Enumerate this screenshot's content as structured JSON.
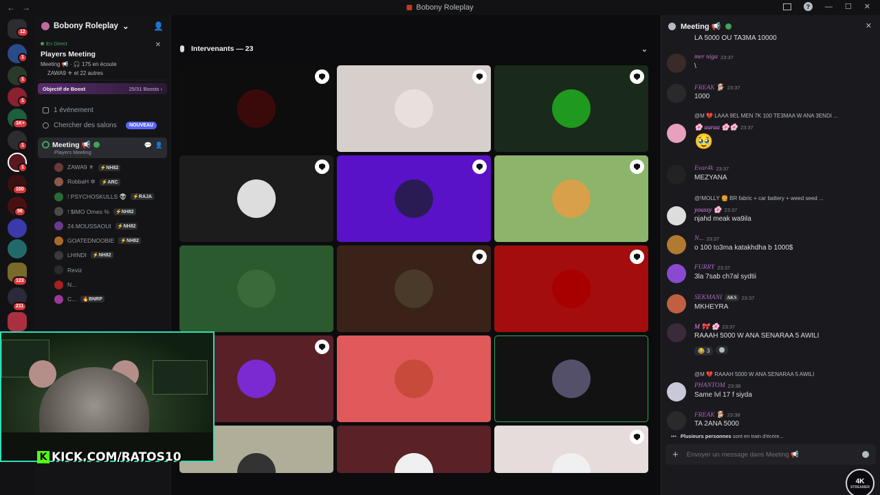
{
  "window": {
    "title": "Bobony Roleplay",
    "back": "←",
    "forward": "→",
    "help": "?"
  },
  "rail": {
    "badges": [
      "12",
      "1",
      "1",
      "1",
      "1K+",
      "1",
      "1",
      "100",
      "56",
      "123",
      "211"
    ]
  },
  "guild": {
    "name": "Bobony Roleplay"
  },
  "live": {
    "status": "En Direct",
    "title": "Players Meeting",
    "stats": "Meeting 📢 · 🎧 175 en écoute",
    "speakers": "ZAWA9 ⚜ et 22 autres"
  },
  "boost": {
    "label": "Objectif de Boost",
    "progress": "25/31 Boosts ›",
    "progress_ratio": 0.806
  },
  "nav": {
    "events": "1 événement",
    "browse": "Chercher des salons",
    "new_badge": "NOUVEAU"
  },
  "voice_channel": {
    "name": "Meeting 📢",
    "subtitle": "Players Meeting"
  },
  "members": [
    {
      "name": "ZAWA9 ⚜",
      "tag": "⚡NH82"
    },
    {
      "name": "RobbaH ✲",
      "tag": "⚡ARC"
    },
    {
      "name": "! PSYCHOSKULLS 👽",
      "tag": "⚡RAJA"
    },
    {
      "name": "! $IMO Ornes %",
      "tag": "⚡NH82"
    },
    {
      "name": "24.MOUSSAOUI",
      "tag": "⚡NH82"
    },
    {
      "name": "GOATEDNOOBIE",
      "tag": "⚡NH82"
    },
    {
      "name": "LHINDI",
      "tag": "⚡NH82"
    },
    {
      "name": "Reviz",
      "tag": ""
    },
    {
      "name": "N...",
      "tag": ""
    },
    {
      "name": "C...",
      "tag": "🔥BNRP"
    }
  ],
  "stage": {
    "header": "Intervenants — 23",
    "chevron": "⌄"
  },
  "kick": {
    "text": "KICK.COM/RATOS10",
    "logo": "K"
  },
  "chat": {
    "title": "Meeting 📢",
    "close": "✕",
    "top_cut": "LA 5000 OU TA3MA 10000",
    "messages": [
      {
        "name": "mer niga",
        "time": "23:37",
        "text": "\\",
        "color": "#c27ac0"
      },
      {
        "name": "FREAK 🐕",
        "time": "23:37",
        "text": "1000",
        "color": "#b35ac0"
      },
      {
        "reply": "@M 💔 LAAA 9EL MEN 7K 100 TE3MAA W ANA 3ENDI ...",
        "name": "🌸 aurаа 🌸🌸",
        "time": "23:37",
        "text": "🥹",
        "color": "#f47fff"
      },
      {
        "name": "Evar4k",
        "time": "23:37",
        "text": "MEZYANA",
        "color": "#a66bbd"
      },
      {
        "reply": "@!MOLLY 🍔 BR fabric + car battery + weed seed ...",
        "name": "youssy 🌸",
        "time": "23:37",
        "text": "njahd meak wa9ila",
        "color": "#f47fff"
      },
      {
        "name": "N...",
        "time": "23:37",
        "text": "o 100 to3ma katakhdha b 1000$",
        "color": "#a66bbd"
      },
      {
        "name": "FURRY",
        "time": "23:37",
        "text": "3la 7sab ch7al sydtii",
        "color": "#a66bbd"
      },
      {
        "name": "SEKMANI",
        "tag": "AKS",
        "time": "23:37",
        "text": "MKHEYRA",
        "color": "#a66bbd"
      },
      {
        "name": "M 🎀 🌸",
        "time": "23:37",
        "text": "RAAAH 5000 W ANA SENARAA 5 AWILI",
        "color": "#f47fff",
        "reaction": "😂",
        "reaction_count": "3"
      },
      {
        "reply": "@M 💔 RAAAH 5000 W ANA SENARAA 5 AWILI",
        "name": "PHANTOM",
        "time": "23:38",
        "text": "Same lvl 17 f siyda",
        "color": "#a66bbd"
      },
      {
        "name": "FREAK 🐕",
        "time": "23:38",
        "text": "TA 2ANA 5000",
        "color": "#b35ac0"
      }
    ],
    "typing": "Plusieurs personnes",
    "typing_suffix": "sont en train d'écrire...",
    "placeholder": "Envoyer un message dans Meeting 📢"
  },
  "watermark": {
    "top": "4K",
    "bottom": "STREAMER"
  }
}
